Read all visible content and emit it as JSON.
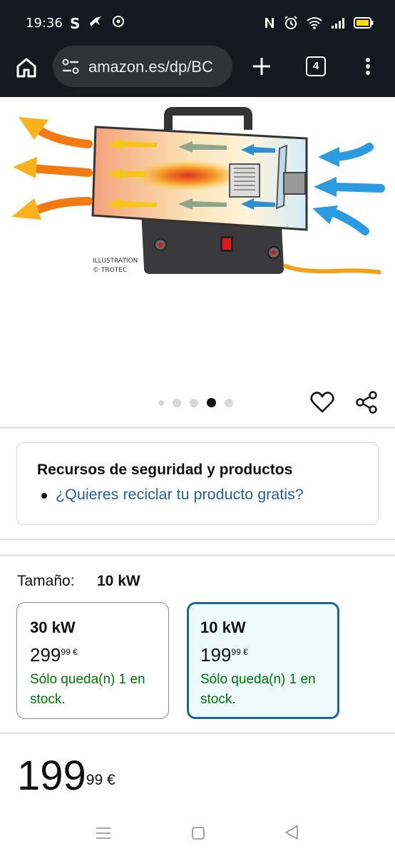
{
  "status_bar": {
    "time": "19:36",
    "icons_left": [
      "skype-icon",
      "bird-icon",
      "sync-icon"
    ],
    "icons_right": [
      "nfc-icon",
      "alarm-icon",
      "wifi-icon",
      "signal-icon",
      "battery-icon"
    ]
  },
  "browser": {
    "url": "amazon.es/dp/BC",
    "tab_count": "4"
  },
  "product_image": {
    "caption_line1": "ILLUSTRATION",
    "caption_line2": "© TROTEC",
    "carousel_total": 5,
    "carousel_active_index": 4
  },
  "safety": {
    "title": "Recursos de seguridad y productos",
    "link": "¿Quieres reciclar tu producto gratis?"
  },
  "size": {
    "label": "Tamaño:",
    "selected": "10 kW",
    "options": [
      {
        "name": "30 kW",
        "price_whole": "299",
        "price_fraction": "99",
        "currency": "€",
        "stock": "Sólo queda(n) 1 en stock."
      },
      {
        "name": "10 kW",
        "price_whole": "199",
        "price_fraction": "99",
        "currency": "€",
        "stock": "Sólo queda(n) 1 en stock."
      }
    ]
  },
  "price": {
    "whole": "199",
    "fraction": "99",
    "currency": "€"
  },
  "colors": {
    "header_bg": "#131921",
    "link": "#2162a1",
    "stock_green": "#007600",
    "selected_border": "#2162a1",
    "selected_bg": "#edfafe"
  }
}
